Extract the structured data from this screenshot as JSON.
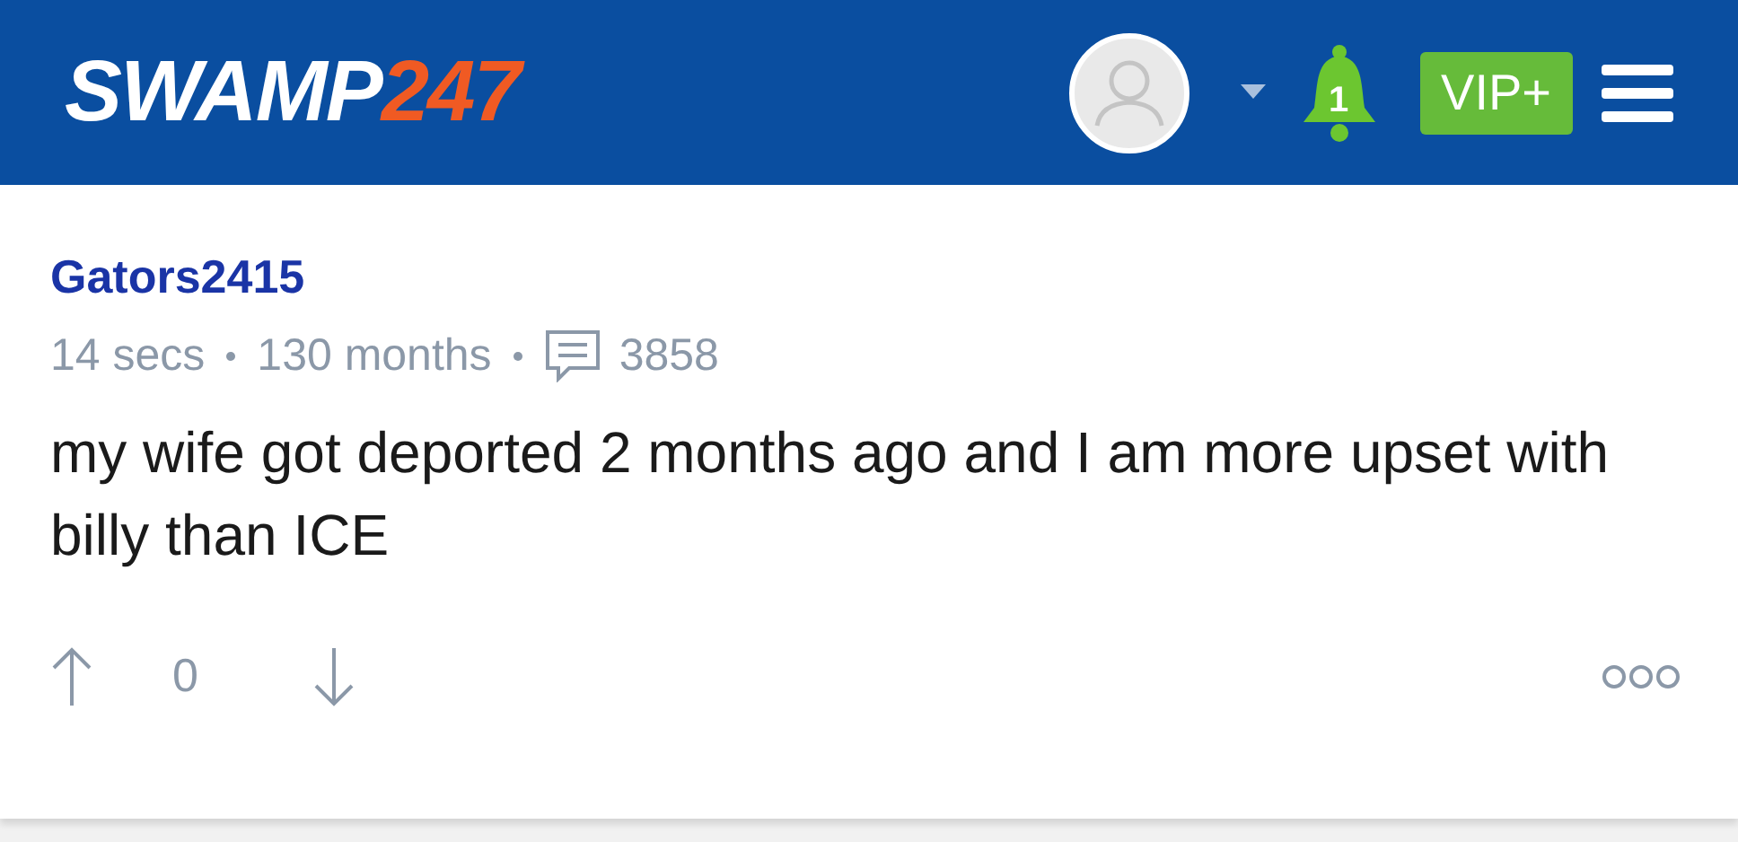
{
  "header": {
    "logo": {
      "word": "SWAMP",
      "number": "247"
    },
    "notifications": {
      "count": "1"
    },
    "vip_button": "VIP+"
  },
  "post": {
    "author": "Gators2415",
    "time": "14 secs",
    "membership": "130 months",
    "post_count": "3858",
    "body": "my wife got deported 2 months ago and I am more upset with billy than ICE",
    "votes": "0"
  }
}
